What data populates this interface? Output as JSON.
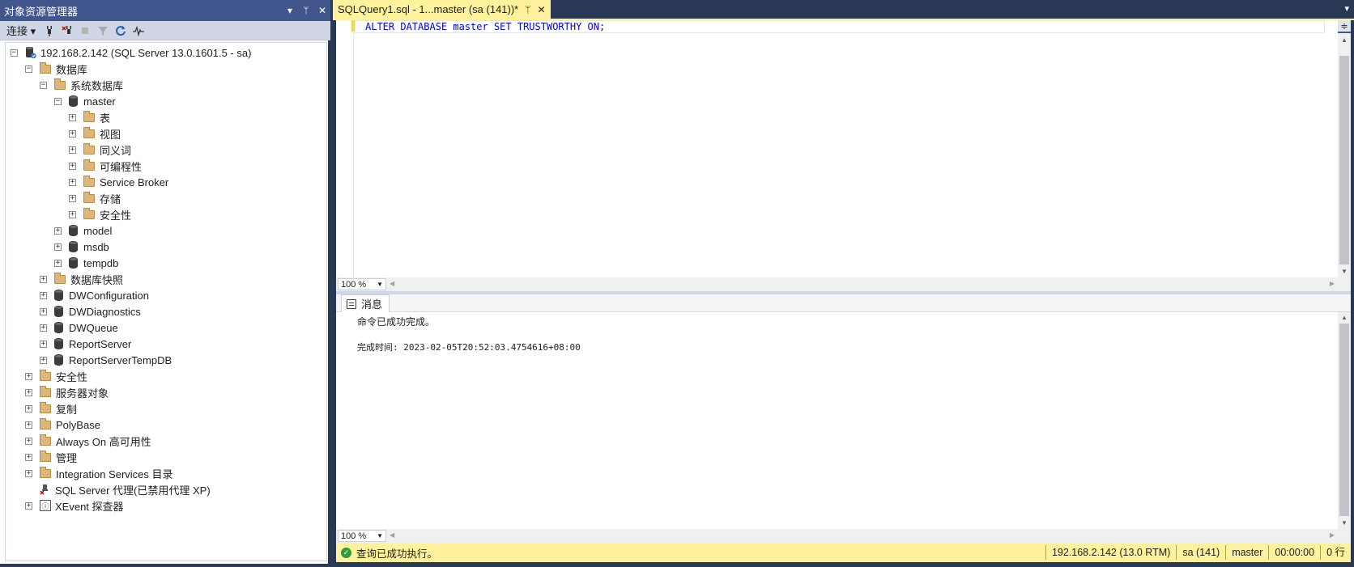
{
  "object_explorer": {
    "title": "对象资源管理器",
    "title_buttons": [
      "▾",
      "ᛘ",
      "✕"
    ],
    "toolbar": {
      "connect_label": "连接"
    },
    "tree": [
      {
        "label": "192.168.2.142 (SQL Server 13.0.1601.5 - sa)",
        "level": 0,
        "expander": "−",
        "icon": "server"
      },
      {
        "label": "数据库",
        "level": 1,
        "expander": "−",
        "icon": "folder"
      },
      {
        "label": "系统数据库",
        "level": 2,
        "expander": "−",
        "icon": "folder"
      },
      {
        "label": "master",
        "level": 3,
        "expander": "−",
        "icon": "db"
      },
      {
        "label": "表",
        "level": 4,
        "expander": "+",
        "icon": "folder"
      },
      {
        "label": "视图",
        "level": 4,
        "expander": "+",
        "icon": "folder"
      },
      {
        "label": "同义词",
        "level": 4,
        "expander": "+",
        "icon": "folder"
      },
      {
        "label": "可编程性",
        "level": 4,
        "expander": "+",
        "icon": "folder"
      },
      {
        "label": "Service Broker",
        "level": 4,
        "expander": "+",
        "icon": "folder"
      },
      {
        "label": "存储",
        "level": 4,
        "expander": "+",
        "icon": "folder"
      },
      {
        "label": "安全性",
        "level": 4,
        "expander": "+",
        "icon": "folder"
      },
      {
        "label": "model",
        "level": 3,
        "expander": "+",
        "icon": "db"
      },
      {
        "label": "msdb",
        "level": 3,
        "expander": "+",
        "icon": "db"
      },
      {
        "label": "tempdb",
        "level": 3,
        "expander": "+",
        "icon": "db"
      },
      {
        "label": "数据库快照",
        "level": 2,
        "expander": "+",
        "icon": "folder"
      },
      {
        "label": "DWConfiguration",
        "level": 2,
        "expander": "+",
        "icon": "db"
      },
      {
        "label": "DWDiagnostics",
        "level": 2,
        "expander": "+",
        "icon": "db"
      },
      {
        "label": "DWQueue",
        "level": 2,
        "expander": "+",
        "icon": "db"
      },
      {
        "label": "ReportServer",
        "level": 2,
        "expander": "+",
        "icon": "db"
      },
      {
        "label": "ReportServerTempDB",
        "level": 2,
        "expander": "+",
        "icon": "db"
      },
      {
        "label": "安全性",
        "level": 1,
        "expander": "+",
        "icon": "folder"
      },
      {
        "label": "服务器对象",
        "level": 1,
        "expander": "+",
        "icon": "folder"
      },
      {
        "label": "复制",
        "level": 1,
        "expander": "+",
        "icon": "folder"
      },
      {
        "label": "PolyBase",
        "level": 1,
        "expander": "+",
        "icon": "folder"
      },
      {
        "label": "Always On 高可用性",
        "level": 1,
        "expander": "+",
        "icon": "folder"
      },
      {
        "label": "管理",
        "level": 1,
        "expander": "+",
        "icon": "folder"
      },
      {
        "label": "Integration Services 目录",
        "level": 1,
        "expander": "+",
        "icon": "folder"
      },
      {
        "label": "SQL Server 代理(已禁用代理 XP)",
        "level": 1,
        "expander": "",
        "icon": "agent"
      },
      {
        "label": "XEvent 探查器",
        "level": 1,
        "expander": "+",
        "icon": "xevent"
      }
    ]
  },
  "document": {
    "tab_title": "SQLQuery1.sql - 1...master (sa (141))*",
    "tab_pin": "ᛘ",
    "tab_close": "✕",
    "query_text": "ALTER DATABASE master SET TRUSTWORTHY ON;",
    "editor_zoom": "100 %",
    "results_zoom": "100 %",
    "results_tab_label": "消息",
    "messages": [
      "命令已成功完成。",
      "",
      "完成时间: 2023-02-05T20:52:03.4754616+08:00"
    ]
  },
  "status_bar": {
    "message": "查询已成功执行。",
    "server": "192.168.2.142 (13.0 RTM)",
    "user": "sa (141)",
    "database": "master",
    "elapsed": "00:00:00",
    "rows": "0 行"
  },
  "colors": {
    "title_bar": "#40568d",
    "tab_active": "#fff29d",
    "keyword": "#0000ff",
    "frame": "#293955"
  }
}
